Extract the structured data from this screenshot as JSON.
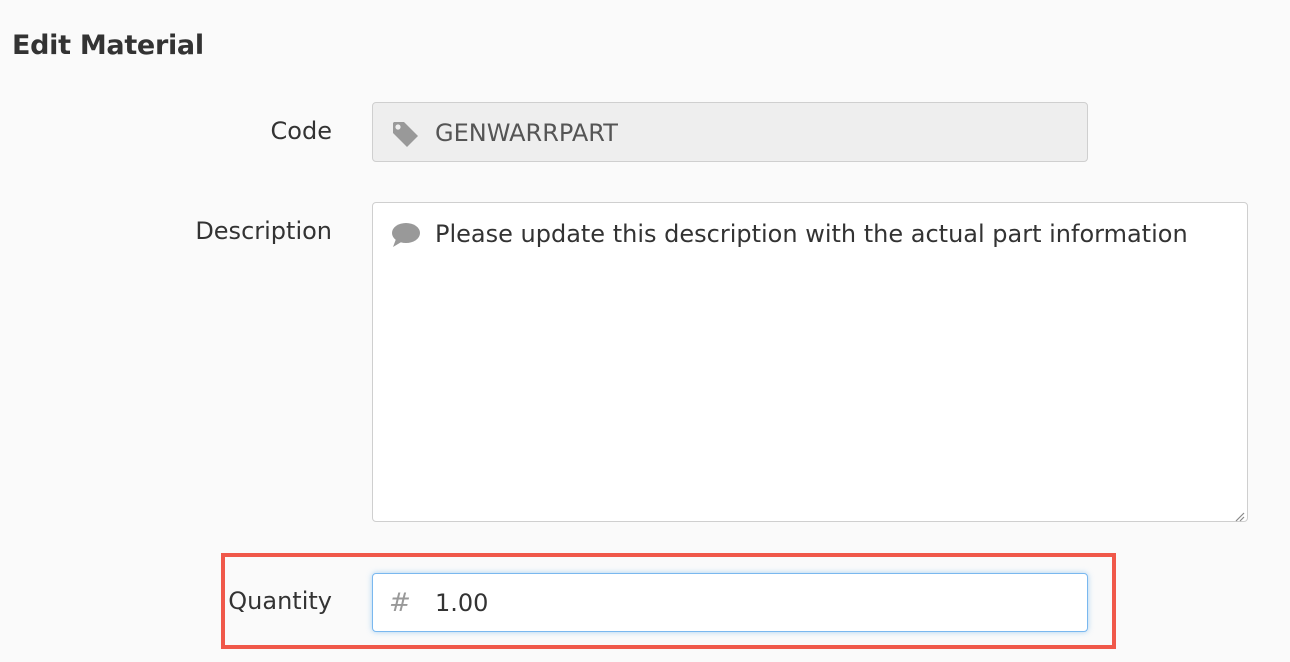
{
  "form": {
    "title": "Edit Material",
    "code": {
      "label": "Code",
      "value": "GENWARRPART",
      "icon": "tag-icon"
    },
    "description": {
      "label": "Description",
      "value": "Please update this description with the actual part information",
      "icon": "comment-icon"
    },
    "quantity": {
      "label": "Quantity",
      "value": "1.00",
      "icon": "hash-icon",
      "icon_glyph": "#"
    }
  },
  "colors": {
    "highlight": "#f0584a",
    "focus_border": "#7ab8ef",
    "readonly_bg": "#eeeeee",
    "icon": "#999999"
  }
}
